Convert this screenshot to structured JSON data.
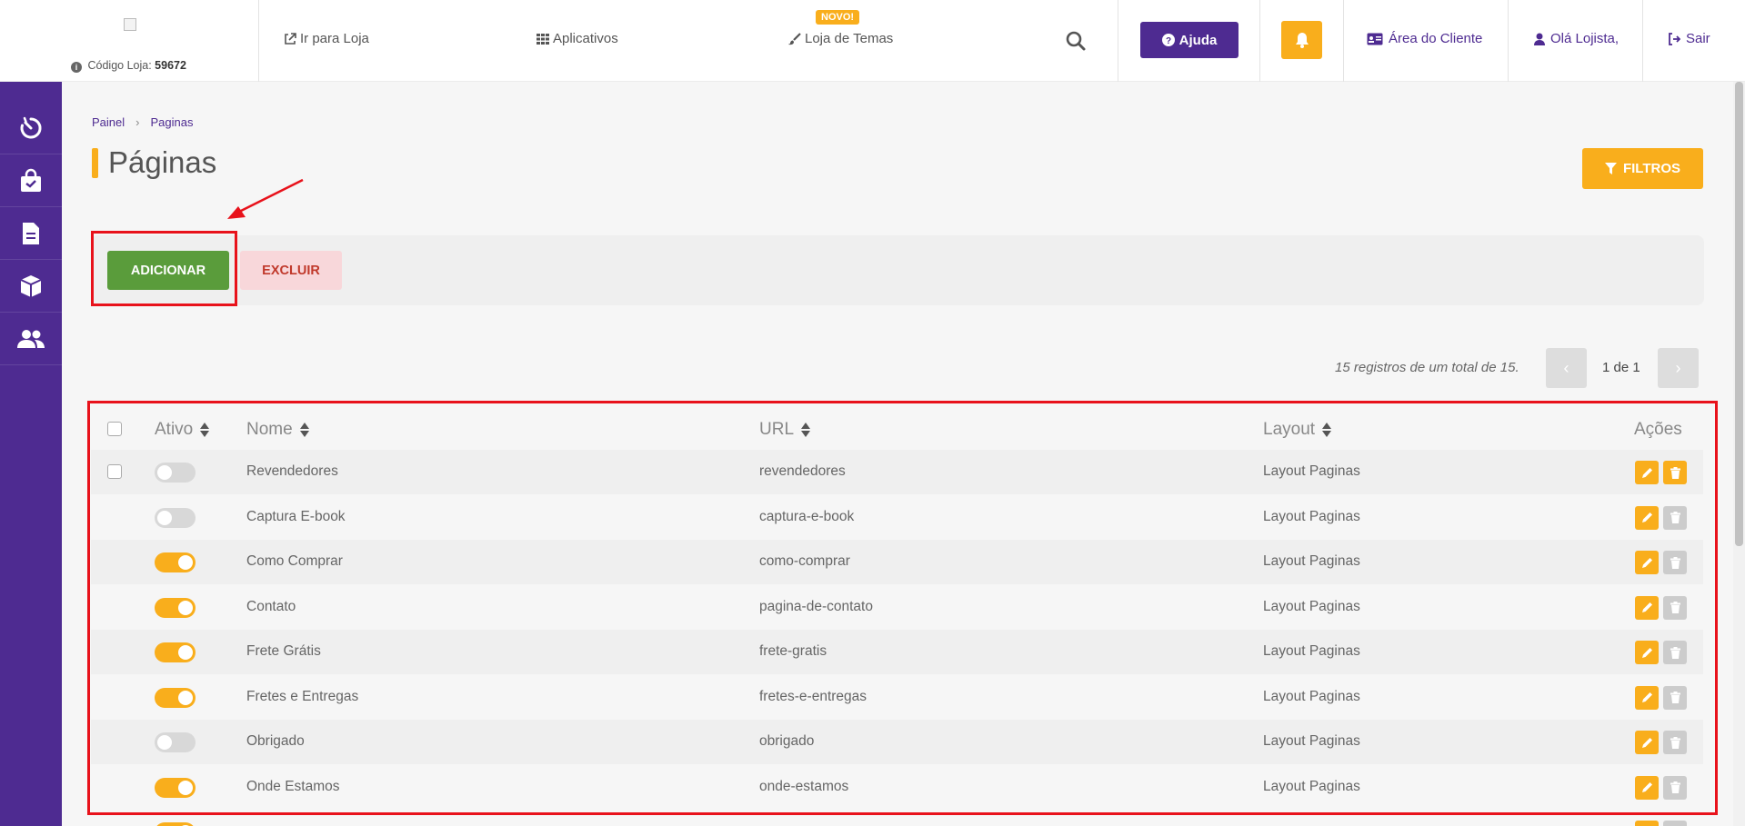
{
  "header": {
    "store_code_label": "Código Loja:",
    "store_code": "59672",
    "nav": {
      "store": "Ir para Loja",
      "apps": "Aplicativos",
      "themes": "Loja de Temas",
      "themes_badge": "NOVO!"
    },
    "help": "Ajuda",
    "client_area": "Área do Cliente",
    "greeting": "Olá Lojista,",
    "logout": "Sair"
  },
  "sidebar": {
    "items": [
      {
        "icon": "dashboard-icon"
      },
      {
        "icon": "shopping-bag-icon"
      },
      {
        "icon": "document-icon"
      },
      {
        "icon": "box-icon"
      },
      {
        "icon": "users-icon"
      }
    ]
  },
  "breadcrumb": [
    "Painel",
    "Paginas"
  ],
  "page": {
    "title": "Páginas",
    "filters_button": "FILTROS",
    "add_button": "ADICIONAR",
    "delete_button": "EXCLUIR",
    "records_info": "15 registros de um total de 15.",
    "pagination": "1 de 1"
  },
  "table": {
    "columns": [
      "Ativo",
      "Nome",
      "URL",
      "Layout",
      "Ações"
    ],
    "rows": [
      {
        "active": false,
        "name": "Revendedores",
        "url": "revendedores",
        "layout": "Layout Paginas"
      },
      {
        "active": false,
        "name": "Captura E-book",
        "url": "captura-e-book",
        "layout": "Layout Paginas"
      },
      {
        "active": true,
        "name": "Como Comprar",
        "url": "como-comprar",
        "layout": "Layout Paginas"
      },
      {
        "active": true,
        "name": "Contato",
        "url": "pagina-de-contato",
        "layout": "Layout Paginas"
      },
      {
        "active": true,
        "name": "Frete Grátis",
        "url": "frete-gratis",
        "layout": "Layout Paginas"
      },
      {
        "active": true,
        "name": "Fretes e Entregas",
        "url": "fretes-e-entregas",
        "layout": "Layout Paginas"
      },
      {
        "active": false,
        "name": "Obrigado",
        "url": "obrigado",
        "layout": "Layout Paginas"
      },
      {
        "active": true,
        "name": "Onde Estamos",
        "url": "onde-estamos",
        "layout": "Layout Paginas"
      }
    ]
  },
  "colors": {
    "brand_purple": "#4e2b91",
    "accent_yellow": "#f9ae1c",
    "add_green": "#5a9c3b",
    "highlight_red": "#e8121b"
  }
}
